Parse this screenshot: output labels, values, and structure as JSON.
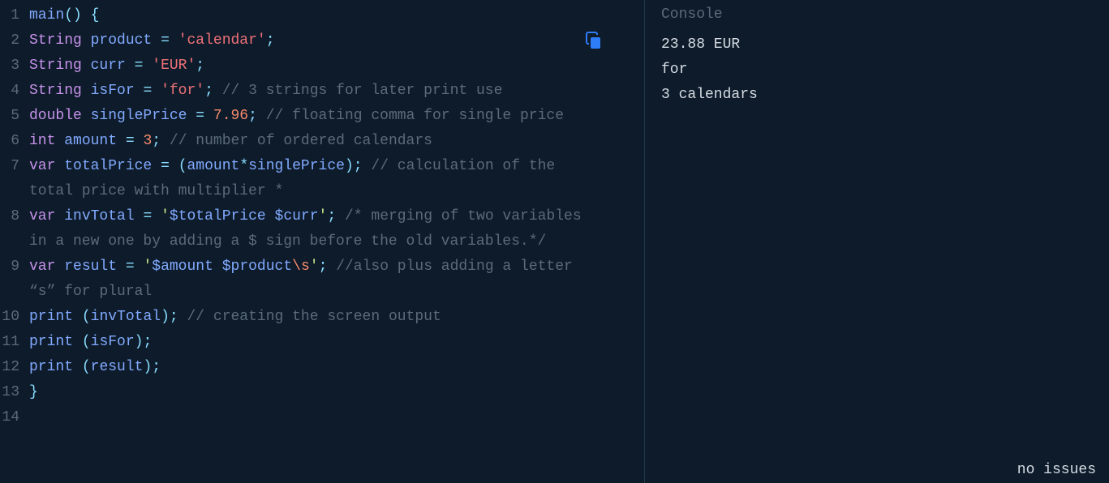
{
  "editor": {
    "lines": [
      {
        "num": 1,
        "tokens": [
          [
            "main",
            "func"
          ],
          [
            "()",
            "punct"
          ],
          [
            " ",
            "plain"
          ],
          [
            "{",
            "punct"
          ]
        ]
      },
      {
        "num": 2,
        "tokens": [
          [
            "String",
            "type"
          ],
          [
            " ",
            "plain"
          ],
          [
            "product",
            "ident"
          ],
          [
            " ",
            "plain"
          ],
          [
            "=",
            "op"
          ],
          [
            " ",
            "plain"
          ],
          [
            "'calendar'",
            "string-alt"
          ],
          [
            ";",
            "punct"
          ]
        ]
      },
      {
        "num": 3,
        "tokens": [
          [
            "String",
            "type"
          ],
          [
            " ",
            "plain"
          ],
          [
            "curr",
            "ident"
          ],
          [
            " ",
            "plain"
          ],
          [
            "=",
            "op"
          ],
          [
            " ",
            "plain"
          ],
          [
            "'EUR'",
            "string-alt"
          ],
          [
            ";",
            "punct"
          ]
        ]
      },
      {
        "num": 4,
        "tokens": [
          [
            "String",
            "type"
          ],
          [
            " ",
            "plain"
          ],
          [
            "isFor",
            "ident"
          ],
          [
            " ",
            "plain"
          ],
          [
            "=",
            "op"
          ],
          [
            " ",
            "plain"
          ],
          [
            "'for'",
            "string-alt"
          ],
          [
            ";",
            "punct"
          ],
          [
            " ",
            "plain"
          ],
          [
            "// 3 strings for later print use",
            "comment"
          ]
        ]
      },
      {
        "num": 5,
        "tokens": [
          [
            "double",
            "type"
          ],
          [
            " ",
            "plain"
          ],
          [
            "singlePrice",
            "ident"
          ],
          [
            " ",
            "plain"
          ],
          [
            "=",
            "op"
          ],
          [
            " ",
            "plain"
          ],
          [
            "7.96",
            "num"
          ],
          [
            ";",
            "punct"
          ],
          [
            " ",
            "plain"
          ],
          [
            "// floating comma for single price",
            "comment"
          ]
        ]
      },
      {
        "num": 6,
        "tokens": [
          [
            "int",
            "type"
          ],
          [
            " ",
            "plain"
          ],
          [
            "amount",
            "ident"
          ],
          [
            " ",
            "plain"
          ],
          [
            "=",
            "op"
          ],
          [
            " ",
            "plain"
          ],
          [
            "3",
            "num"
          ],
          [
            ";",
            "punct"
          ],
          [
            " ",
            "plain"
          ],
          [
            "// number of ordered calendars",
            "comment"
          ]
        ]
      },
      {
        "num": 7,
        "tokens": [
          [
            "var",
            "kw"
          ],
          [
            " ",
            "plain"
          ],
          [
            "totalPrice",
            "ident"
          ],
          [
            " ",
            "plain"
          ],
          [
            "=",
            "op"
          ],
          [
            " ",
            "plain"
          ],
          [
            "(",
            "punct"
          ],
          [
            "amount",
            "ident"
          ],
          [
            "*",
            "op"
          ],
          [
            "singlePrice",
            "ident"
          ],
          [
            ")",
            "punct"
          ],
          [
            ";",
            "punct"
          ],
          [
            " ",
            "plain"
          ],
          [
            "// calculation of the total price with multiplier *",
            "comment"
          ]
        ]
      },
      {
        "num": 8,
        "tokens": [
          [
            "var",
            "kw"
          ],
          [
            " ",
            "plain"
          ],
          [
            "invTotal",
            "ident"
          ],
          [
            " ",
            "plain"
          ],
          [
            "=",
            "op"
          ],
          [
            " ",
            "plain"
          ],
          [
            "'",
            "string"
          ],
          [
            "$totalPrice",
            "interp"
          ],
          [
            " ",
            "string"
          ],
          [
            "$curr",
            "interp"
          ],
          [
            "'",
            "string"
          ],
          [
            ";",
            "punct"
          ],
          [
            " ",
            "plain"
          ],
          [
            "/* merging of two variables in a new one by adding a $ sign before the old variables.*/",
            "comment"
          ]
        ]
      },
      {
        "num": 9,
        "tokens": [
          [
            "var",
            "kw"
          ],
          [
            " ",
            "plain"
          ],
          [
            "result",
            "ident"
          ],
          [
            " ",
            "plain"
          ],
          [
            "=",
            "op"
          ],
          [
            " ",
            "plain"
          ],
          [
            "'",
            "string"
          ],
          [
            "$amount",
            "interp"
          ],
          [
            " ",
            "string"
          ],
          [
            "$product",
            "interp"
          ],
          [
            "\\s",
            "esc"
          ],
          [
            "'",
            "string"
          ],
          [
            ";",
            "punct"
          ],
          [
            " ",
            "plain"
          ],
          [
            "//also plus adding a letter “s” for plural",
            "comment"
          ]
        ]
      },
      {
        "num": 10,
        "tokens": [
          [
            "print",
            "func"
          ],
          [
            " ",
            "plain"
          ],
          [
            "(",
            "punct"
          ],
          [
            "invTotal",
            "ident"
          ],
          [
            ")",
            "punct"
          ],
          [
            ";",
            "punct"
          ],
          [
            " ",
            "plain"
          ],
          [
            "// creating the screen output",
            "comment"
          ]
        ]
      },
      {
        "num": 11,
        "tokens": [
          [
            "print",
            "func"
          ],
          [
            " ",
            "plain"
          ],
          [
            "(",
            "punct"
          ],
          [
            "isFor",
            "ident"
          ],
          [
            ")",
            "punct"
          ],
          [
            ";",
            "punct"
          ]
        ]
      },
      {
        "num": 12,
        "tokens": [
          [
            "print",
            "func"
          ],
          [
            " ",
            "plain"
          ],
          [
            "(",
            "punct"
          ],
          [
            "result",
            "ident"
          ],
          [
            ")",
            "punct"
          ],
          [
            ";",
            "punct"
          ]
        ]
      },
      {
        "num": 13,
        "tokens": [
          [
            "}",
            "punct"
          ]
        ]
      },
      {
        "num": 14,
        "tokens": []
      }
    ]
  },
  "console": {
    "title": "Console",
    "output": [
      "23.88 EUR",
      "for",
      "3 calendars"
    ]
  },
  "status": {
    "text": "no issues"
  },
  "icons": {
    "copy": "copy-icon"
  }
}
